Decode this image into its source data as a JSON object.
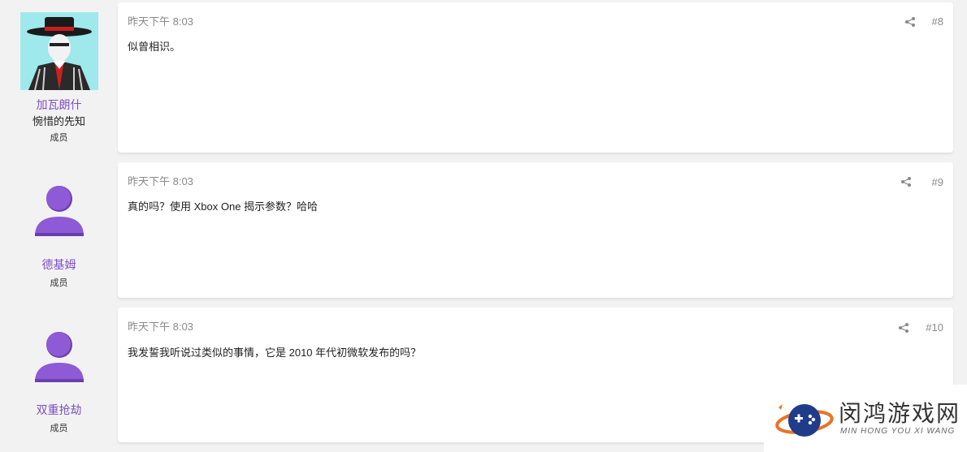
{
  "posts": [
    {
      "username": "加瓦朗什",
      "usertitle": "惋惜的先知",
      "role": "成员",
      "time": "昨天下午 8:03",
      "message": "似曾相识。",
      "number": "#8",
      "avatar": "photo"
    },
    {
      "username": "德基姆",
      "usertitle": "",
      "role": "成员",
      "time": "昨天下午 8:03",
      "message": "真的吗？使用 Xbox One 揭示参数？哈哈",
      "number": "#9",
      "avatar": "generic-user-icon"
    },
    {
      "username": "双重抢劫",
      "usertitle": "",
      "role": "成员",
      "time": "昨天下午 8:03",
      "message": "我发誓我听说过类似的事情，它是 2010 年代初微软发布的吗？",
      "number": "#10",
      "avatar": "generic-user-icon"
    }
  ],
  "watermark": {
    "title": "闵鸿游戏网",
    "subtitle": "MIN HONG YOU XI WANG"
  },
  "colors": {
    "username": "#7d4fc1",
    "avatar": "#7e57c2",
    "background": "#f2f2f2",
    "card": "#ffffff"
  },
  "icons": [
    "share-icon",
    "user-icon",
    "gamepad-logo-icon"
  ]
}
